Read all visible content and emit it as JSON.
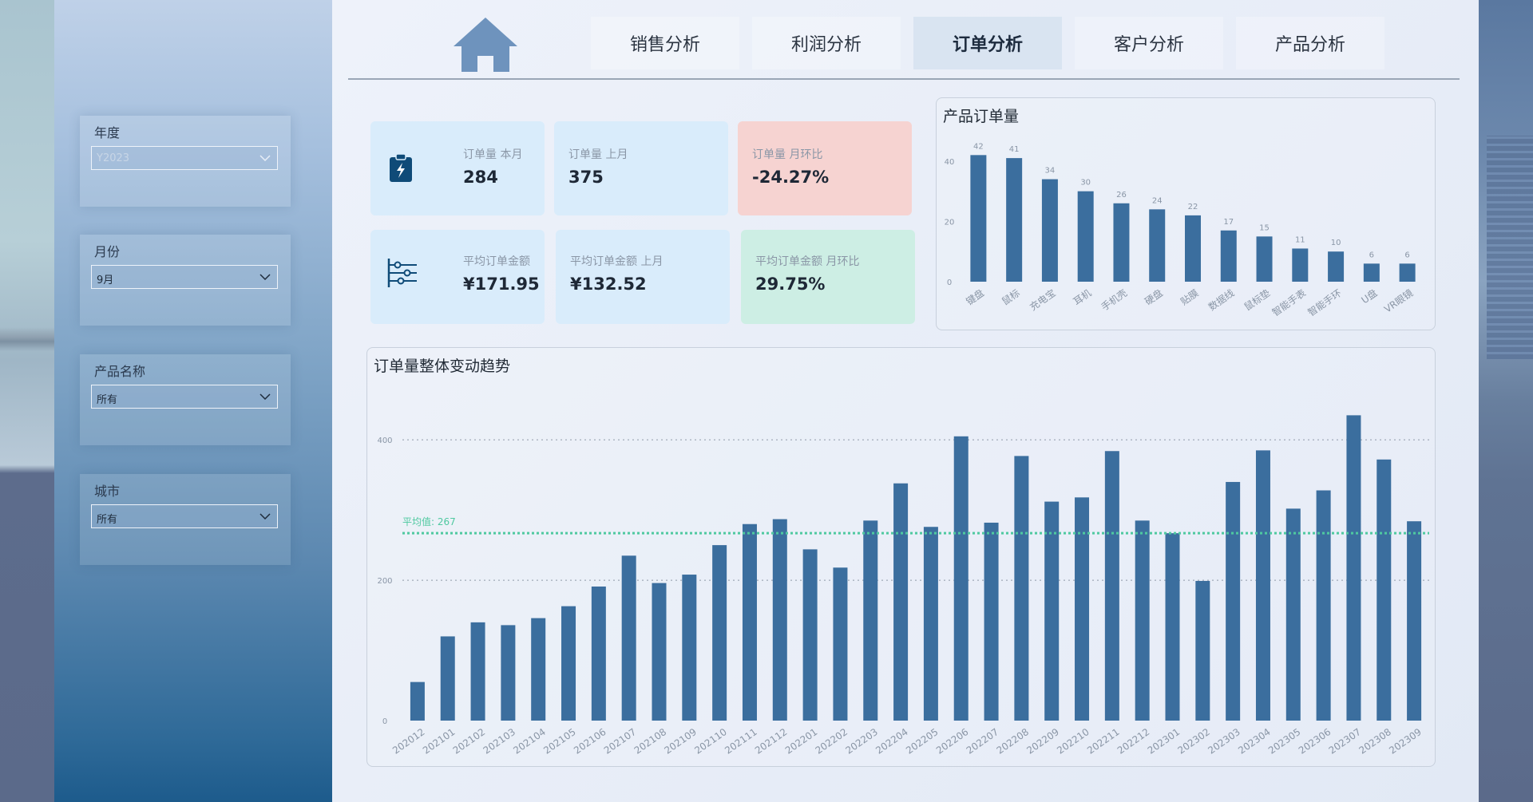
{
  "sidebar": {
    "filters": [
      {
        "label": "年度",
        "value": "Y2023",
        "dim": true
      },
      {
        "label": "月份",
        "value": "9月"
      },
      {
        "label": "产品名称",
        "value": "所有"
      },
      {
        "label": "城市",
        "value": "所有"
      }
    ]
  },
  "nav": {
    "tabs": [
      "销售分析",
      "利润分析",
      "订单分析",
      "客户分析",
      "产品分析"
    ],
    "active": "订单分析"
  },
  "kpis": {
    "orders_this_month": {
      "label": "订单量 本月",
      "value": "284"
    },
    "orders_last_month": {
      "label": "订单量 上月",
      "value": "375"
    },
    "orders_mom": {
      "label": "订单量 月环比",
      "value": "-24.27%"
    },
    "avg_amount": {
      "label": "平均订单金额",
      "value": "¥171.95"
    },
    "avg_amount_last": {
      "label": "平均订单金额 上月",
      "value": "¥132.52"
    },
    "avg_amount_mom": {
      "label": "平均订单金额 月环比",
      "value": "29.75%"
    }
  },
  "colors": {
    "bar": "#3b6e9e",
    "avg_line": "#4fc9a0",
    "red_card": "#f6d3d1",
    "green_card": "#cdeee4"
  },
  "chart_data": [
    {
      "type": "bar",
      "title": "产品订单量",
      "categories": [
        "键盘",
        "鼠标",
        "充电宝",
        "耳机",
        "手机壳",
        "硬盘",
        "贴膜",
        "数据线",
        "鼠标垫",
        "智能手表",
        "智能手环",
        "U盘",
        "VR眼镜"
      ],
      "values": [
        42,
        41,
        34,
        30,
        26,
        24,
        22,
        17,
        15,
        11,
        10,
        6,
        6
      ],
      "ylim": [
        0,
        45
      ],
      "yticks": [
        0,
        20,
        40
      ],
      "data_labels": true
    },
    {
      "type": "bar",
      "title": "订单量整体变动趋势",
      "categories": [
        "202012",
        "202101",
        "202102",
        "202103",
        "202104",
        "202105",
        "202106",
        "202107",
        "202108",
        "202109",
        "202110",
        "202111",
        "202112",
        "202201",
        "202202",
        "202203",
        "202204",
        "202205",
        "202206",
        "202207",
        "202208",
        "202209",
        "202210",
        "202211",
        "202212",
        "202301",
        "202302",
        "202303",
        "202304",
        "202305",
        "202306",
        "202307",
        "202308",
        "202309"
      ],
      "values": [
        55,
        120,
        140,
        136,
        146,
        163,
        191,
        235,
        196,
        208,
        250,
        280,
        287,
        244,
        218,
        285,
        338,
        276,
        405,
        282,
        377,
        312,
        318,
        384,
        285,
        267,
        199,
        340,
        385,
        302,
        328,
        435,
        372,
        284
      ],
      "ylim": [
        0,
        440
      ],
      "yticks": [
        0,
        200,
        400
      ],
      "reference_line": {
        "label": "平均值",
        "value": 267,
        "text": "平均值: 267"
      }
    }
  ]
}
